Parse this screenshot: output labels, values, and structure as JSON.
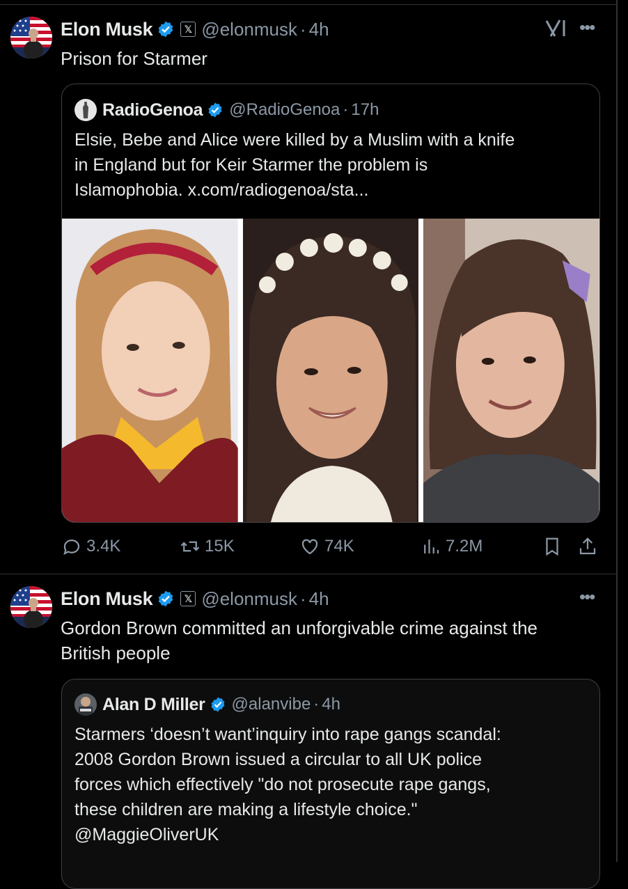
{
  "tweets": [
    {
      "author_name": "Elon Musk",
      "author_handle": "@elonmusk",
      "time": "4h",
      "affiliation_icon": "x-affiliate-icon",
      "text": "Prison for Starmer",
      "quote": {
        "author_name": "RadioGenoa",
        "author_handle": "@RadioGenoa",
        "time": "17h",
        "text_lines": [
          "Elsie, Bebe and Alice were killed by a Muslim with a knife",
          "in England but for Keir Starmer the problem is",
          "Islamophobia.  x.com/radiogenoa/sta..."
        ],
        "photos": [
          "girl-photo-red-headband",
          "girl-photo-flower-crown",
          "girl-photo-grey-top"
        ]
      },
      "stats": {
        "replies": "3.4K",
        "reposts": "15K",
        "likes": "74K",
        "views": "7.2M"
      }
    },
    {
      "author_name": "Elon Musk",
      "author_handle": "@elonmusk",
      "time": "4h",
      "text_lines": [
        "Gordon Brown committed an unforgivable crime against the",
        "British people"
      ],
      "quote": {
        "author_name": "Alan D Miller",
        "author_handle": "@alanvibe",
        "time": "4h",
        "text_lines": [
          "Starmers ‘doesn’t want’inquiry into rape gangs scandal:",
          "2008 Gordon Brown issued a circular to all UK police",
          "forces which effectively \"do not prosecute rape gangs,",
          "these children are making a lifestyle choice.\"",
          "@MaggieOliverUK"
        ]
      }
    }
  ],
  "colors": {
    "background": "#000000",
    "text": "#e7e9ea",
    "muted": "#8b98a5",
    "verified": "#1d9bf0",
    "border": "#2f3336"
  },
  "icons": [
    "verified-badge-icon",
    "grok-icon",
    "more-icon",
    "reply-icon",
    "repost-icon",
    "like-icon",
    "views-icon",
    "bookmark-icon",
    "share-icon"
  ]
}
